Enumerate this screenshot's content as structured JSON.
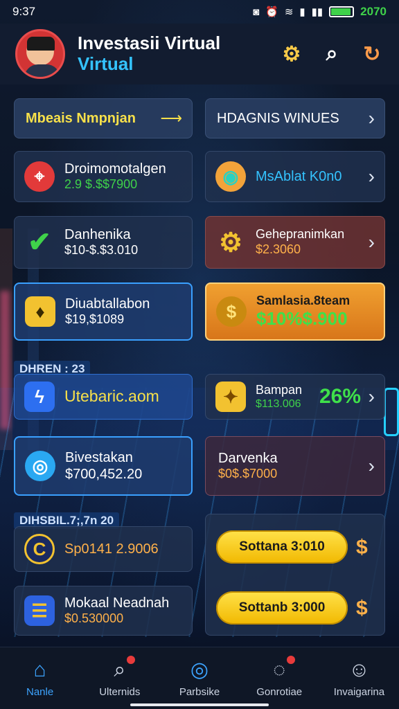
{
  "status_bar": {
    "time": "9:37",
    "battery_text": "2070"
  },
  "header": {
    "title_line1": "Investasii Virtual",
    "title_line2": "Virtual",
    "icons": [
      "gear-icon",
      "search-icon",
      "refresh-icon"
    ]
  },
  "left_cards": [
    {
      "name": "Mbeais Nmpnjan",
      "value": "",
      "icon": "arrow-icon"
    },
    {
      "name": "Droimomotalgen",
      "value": "2.9 $.$$7900",
      "icon": "pin-icon"
    },
    {
      "name": "Danhenika",
      "value": "$10-$.$3.010",
      "icon": "check-icon"
    },
    {
      "name": "Diuabtallabon",
      "value": "$19,$1089",
      "icon": "gift-icon"
    },
    {
      "name": "Utebaric.aom",
      "value": "",
      "icon": "bolt-icon",
      "tag": "DHREN : 23"
    },
    {
      "name": "Bivestakan",
      "value": "$700,452.20",
      "icon": "target-icon"
    },
    {
      "name": "Sp0141 2.9006",
      "value": "",
      "icon": "coin-icon",
      "tag": "DIHSBIL.7;,7n 20"
    },
    {
      "name": "Mokaal Neadnah",
      "value": "$0.530000",
      "icon": "wallet-icon"
    }
  ],
  "right_cards": [
    {
      "name": "HDAGNIS WINUES",
      "value": "",
      "icon": ""
    },
    {
      "name": "MsAblat K0n0",
      "value": "",
      "icon": "jar-icon"
    },
    {
      "name": "Gehepranimkan",
      "value": "$2.3060",
      "icon": "gear-gold-icon"
    },
    {
      "name": "Samlasia.8team",
      "value": "$10%$.900",
      "icon": "coin-gold-icon"
    },
    {
      "name": "Bampan",
      "value": "$113.006",
      "percent": "26%",
      "icon": "ticket-icon"
    },
    {
      "name": "Darvenka",
      "value": "$0$.$7000",
      "icon": ""
    }
  ],
  "pills": [
    {
      "label": "Sottana 3:010",
      "icon": "dollar-icon"
    },
    {
      "label": "Sottanb 3:000",
      "icon": "dollar-icon"
    }
  ],
  "nav": [
    {
      "label": "Nanle",
      "icon": "home-icon",
      "active": true
    },
    {
      "label": "Ulternids",
      "icon": "search-icon",
      "badge": true
    },
    {
      "label": "Parbsike",
      "icon": "compass-icon"
    },
    {
      "label": "Gonrotiae",
      "icon": "chat-icon",
      "badge": true
    },
    {
      "label": "Invaigarina",
      "icon": "user-icon"
    }
  ],
  "colors": {
    "accent_blue": "#34c3ff",
    "green_value": "#3fd24a",
    "gold": "#f1b800",
    "orange_value": "#ffb14a"
  }
}
